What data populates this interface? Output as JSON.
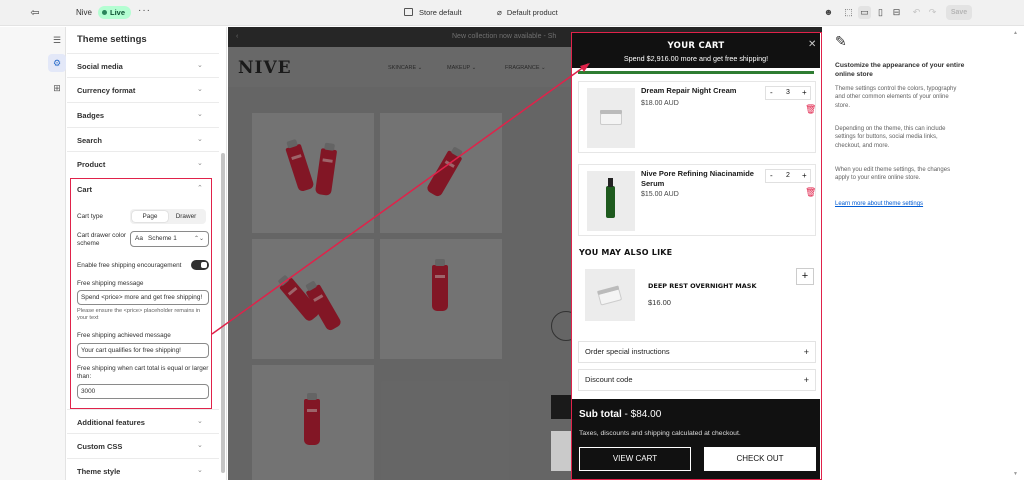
{
  "topbar": {
    "exit_icon": "exit-icon",
    "theme_name": "Nive",
    "live_badge": "Live",
    "more": "···",
    "store_default": "Store default",
    "default_product": "Default product",
    "save_label": "Save"
  },
  "panel": {
    "title": "Theme settings",
    "sections_top": [
      "Social media",
      "Currency format",
      "Badges",
      "Search",
      "Product"
    ],
    "cart": {
      "heading": "Cart",
      "cart_type_label": "Cart type",
      "cart_type_options": [
        "Page",
        "Drawer"
      ],
      "cart_type_selected": "Page",
      "scheme_label": "Cart drawer color scheme",
      "scheme_value": "Scheme 1",
      "scheme_aa": "Aa",
      "free_shipping_toggle_label": "Enable free shipping encouragement",
      "free_shipping_toggle_on": true,
      "message_label": "Free shipping message",
      "message_value": "Spend <price> more and get free shipping!",
      "message_helper": "Please ensure the <price> placeholder remains in your text",
      "achieved_label": "Free shipping achieved message",
      "achieved_value": "Your cart qualifies for free shipping!",
      "threshold_label": "Free shipping when cart total is equal or larger than:",
      "threshold_value": "3000"
    },
    "sections_bottom": [
      "Additional features",
      "Custom CSS",
      "Theme style"
    ]
  },
  "preview": {
    "announcement": "New collection now available - Sh",
    "logo": "NIVE",
    "nav": [
      "SKINCARE ⌄",
      "MAKEUP ⌄",
      "FRAGRANCE ⌄"
    ],
    "tile_label": "NIVE"
  },
  "drawer": {
    "title": "YOUR CART",
    "subtitle": "Spend $2,916.00 more and get free shipping!",
    "items": [
      {
        "name": "Dream Repair Night Cream",
        "price": "$18.00 AUD",
        "qty": "3"
      },
      {
        "name": "Nive Pore Refining Niacinamide Serum",
        "price": "$15.00 AUD",
        "qty": "2"
      }
    ],
    "also_like_heading": "YOU MAY ALSO LIKE",
    "recommendation": {
      "name": "DEEP REST OVERNIGHT MASK",
      "price": "$16.00"
    },
    "order_instructions": "Order special instructions",
    "discount_code": "Discount code",
    "subtotal_label": "Sub total",
    "subtotal_value": " - $84.00",
    "tax_note": "Taxes, discounts and shipping calculated at checkout.",
    "view_cart": "VIEW CART",
    "checkout": "CHECK OUT"
  },
  "info": {
    "heading": "Customize the appearance of your entire online store",
    "p1": "Theme settings control the colors, typography and other common elements of your online store.",
    "p2": "Depending on the theme, this can include settings for buttons, social media links, checkout, and more.",
    "p3": "When you edit theme settings, the changes apply to your entire online store.",
    "link": "Learn more about theme settings"
  },
  "colors": {
    "highlight": "#e0224a",
    "live_badge_bg": "#b4fed2",
    "drawer_header": "#111111",
    "progress": "#2e7d32",
    "link": "#005bd3"
  }
}
